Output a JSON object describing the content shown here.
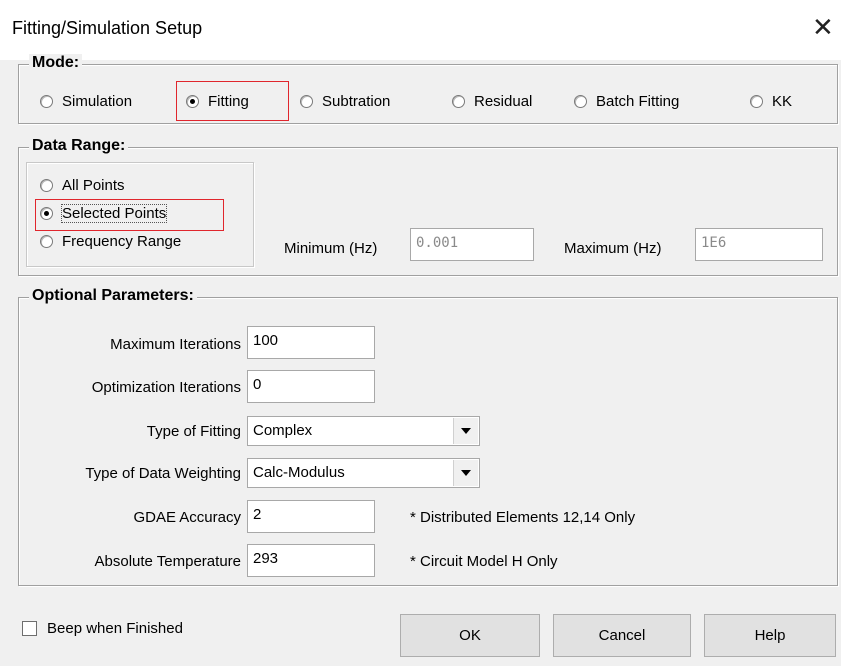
{
  "window": {
    "title": "Fitting/Simulation Setup",
    "close_glyph": "✕"
  },
  "mode": {
    "label": "Mode:",
    "options": [
      {
        "label": "Simulation",
        "checked": false
      },
      {
        "label": "Fitting",
        "checked": true
      },
      {
        "label": "Subtration",
        "checked": false
      },
      {
        "label": "Residual",
        "checked": false
      },
      {
        "label": "Batch Fitting",
        "checked": false
      },
      {
        "label": "KK",
        "checked": false
      }
    ]
  },
  "data_range": {
    "label": "Data Range:",
    "options": [
      {
        "label": "All Points",
        "checked": false
      },
      {
        "label": "Selected Points",
        "checked": true
      },
      {
        "label": "Frequency Range",
        "checked": false
      }
    ],
    "minimum_label": "Minimum (Hz)",
    "minimum_value": "0.001",
    "maximum_label": "Maximum (Hz)",
    "maximum_value": "1E6"
  },
  "optional": {
    "label": "Optional Parameters:",
    "max_iterations_label": "Maximum Iterations",
    "max_iterations_value": "100",
    "opt_iterations_label": "Optimization Iterations",
    "opt_iterations_value": "0",
    "fitting_type_label": "Type of Fitting",
    "fitting_type_value": "Complex",
    "weighting_label": "Type of Data Weighting",
    "weighting_value": "Calc-Modulus",
    "gdae_label": "GDAE Accuracy",
    "gdae_value": "2",
    "gdae_note": "* Distributed Elements 12,14 Only",
    "temperature_label": "Absolute Temperature",
    "temperature_value": "293",
    "temperature_note": "* Circuit Model H Only"
  },
  "footer": {
    "beep_label": "Beep when Finished",
    "beep_checked": false,
    "ok_label": "OK",
    "cancel_label": "Cancel",
    "help_label": "Help"
  },
  "colors": {
    "highlight": "#e0262d",
    "background": "#f0f0f0"
  }
}
